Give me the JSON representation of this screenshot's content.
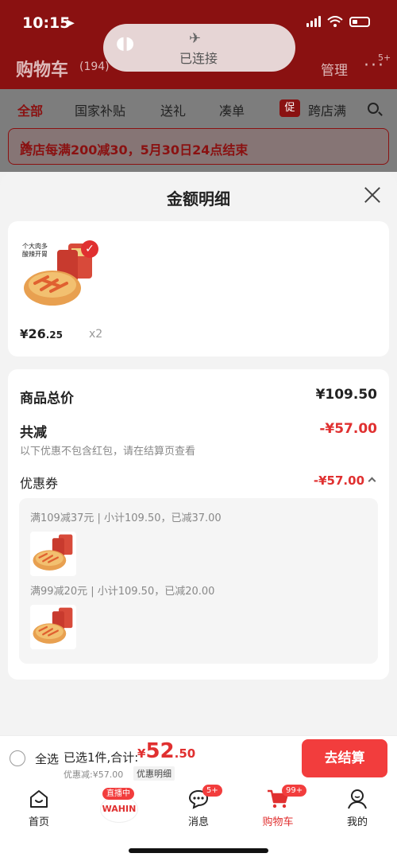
{
  "status_bar": {
    "time": "10:15"
  },
  "toast": {
    "label": "已连接"
  },
  "background_page": {
    "title": "购物车",
    "count": "(194)",
    "manage": "管理",
    "more_badge": "5+",
    "tabs": [
      "全部",
      "国家补贴",
      "送礼",
      "凑单",
      "跨店满"
    ],
    "promo_tag": "促",
    "notice": "跨店每满200减30，5月30日24点结束"
  },
  "sheet": {
    "title": "金额明细",
    "product": {
      "image_caption": "个大肉多 酸辣开胃",
      "price_symbol": "¥",
      "price_int": "26",
      "price_dec": ".25",
      "quantity": "x2"
    },
    "detail": {
      "total_label": "商品总价",
      "total_value": "¥109.50",
      "reduce_label": "共减",
      "reduce_value": "-¥57.00",
      "note": "以下优惠不包含红包，请在结算页查看",
      "coupon_label": "优惠券",
      "coupon_value": "-¥57.00",
      "coupon_lines": [
        "满109减37元 | 小计109.50，已减37.00",
        "满99减20元 | 小计109.50，已减20.00"
      ]
    }
  },
  "bottom_bar": {
    "select_all": "全选",
    "summary": "已选1件,合计:",
    "price_symbol": "¥",
    "price_int": "52",
    "price_dec": ".50",
    "discount_note": "优惠减:¥57.00",
    "detail_link": "优惠明细",
    "checkout": "去结算"
  },
  "tabbar": {
    "items": [
      {
        "label": "首页"
      },
      {
        "label": "",
        "live_badge": "直播中",
        "logo": "WAHIN"
      },
      {
        "label": "消息",
        "badge": "5+"
      },
      {
        "label": "购物车",
        "badge": "99+"
      },
      {
        "label": "我的"
      }
    ]
  },
  "colors": {
    "accent": "#f23d3d",
    "header_dim": "#8a1111"
  }
}
